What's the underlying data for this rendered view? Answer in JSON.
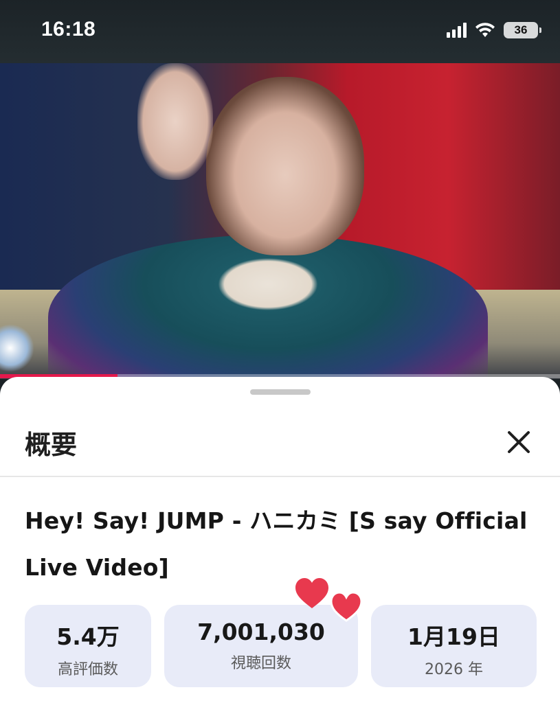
{
  "status_bar": {
    "time": "16:18",
    "battery": "36",
    "icons": [
      "signal-icon",
      "wifi-icon",
      "battery-icon"
    ]
  },
  "video": {
    "progress_fraction": 0.21,
    "progress_color": "#e5194c"
  },
  "sheet": {
    "title": "概要",
    "close_icon": "close-icon",
    "video_title": "Hey! Say! JUMP - ハニカミ [S say Official Live Video]",
    "stats": {
      "likes_value": "5.4万",
      "likes_label": "高評価数",
      "views_value": "7,001,030",
      "views_label": "視聴回数",
      "date_value": "1月19日",
      "date_label": "2026 年"
    },
    "stat_background": "#e8ebf8",
    "decoration": "hearts-sticker"
  }
}
